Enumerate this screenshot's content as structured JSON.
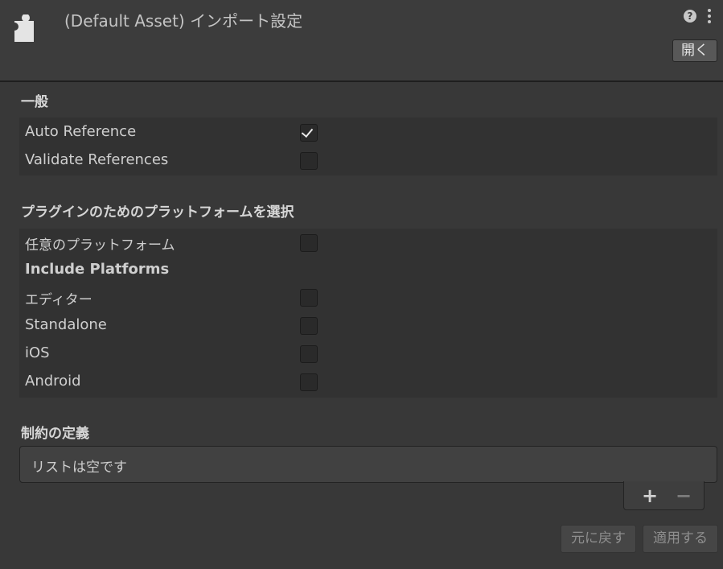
{
  "header": {
    "title": "(Default Asset) インポート設定",
    "open_button": "開く",
    "icons": {
      "asset": "puzzle-asset-icon",
      "help": "help-icon",
      "menu": "kebab-menu-icon"
    }
  },
  "general": {
    "title": "一般",
    "rows": [
      {
        "label": "Auto Reference",
        "checked": true
      },
      {
        "label": "Validate References",
        "checked": false
      }
    ]
  },
  "platforms": {
    "title": "プラグインのためのプラットフォームを選択",
    "any_platform": {
      "label": "任意のプラットフォーム",
      "checked": false
    },
    "include_header": "Include Platforms",
    "rows": [
      {
        "label": "エディター",
        "checked": false
      },
      {
        "label": "Standalone",
        "checked": false
      },
      {
        "label": "iOS",
        "checked": false
      },
      {
        "label": "Android",
        "checked": false
      }
    ]
  },
  "constraints": {
    "title": "制約の定義",
    "empty_text": "リストは空です",
    "add_label": "+",
    "remove_label": "−"
  },
  "footer": {
    "revert_label": "元に戻す",
    "apply_label": "適用する"
  },
  "colors": {
    "background": "#383838",
    "header": "#3c3c3c",
    "panel": "#323232"
  }
}
